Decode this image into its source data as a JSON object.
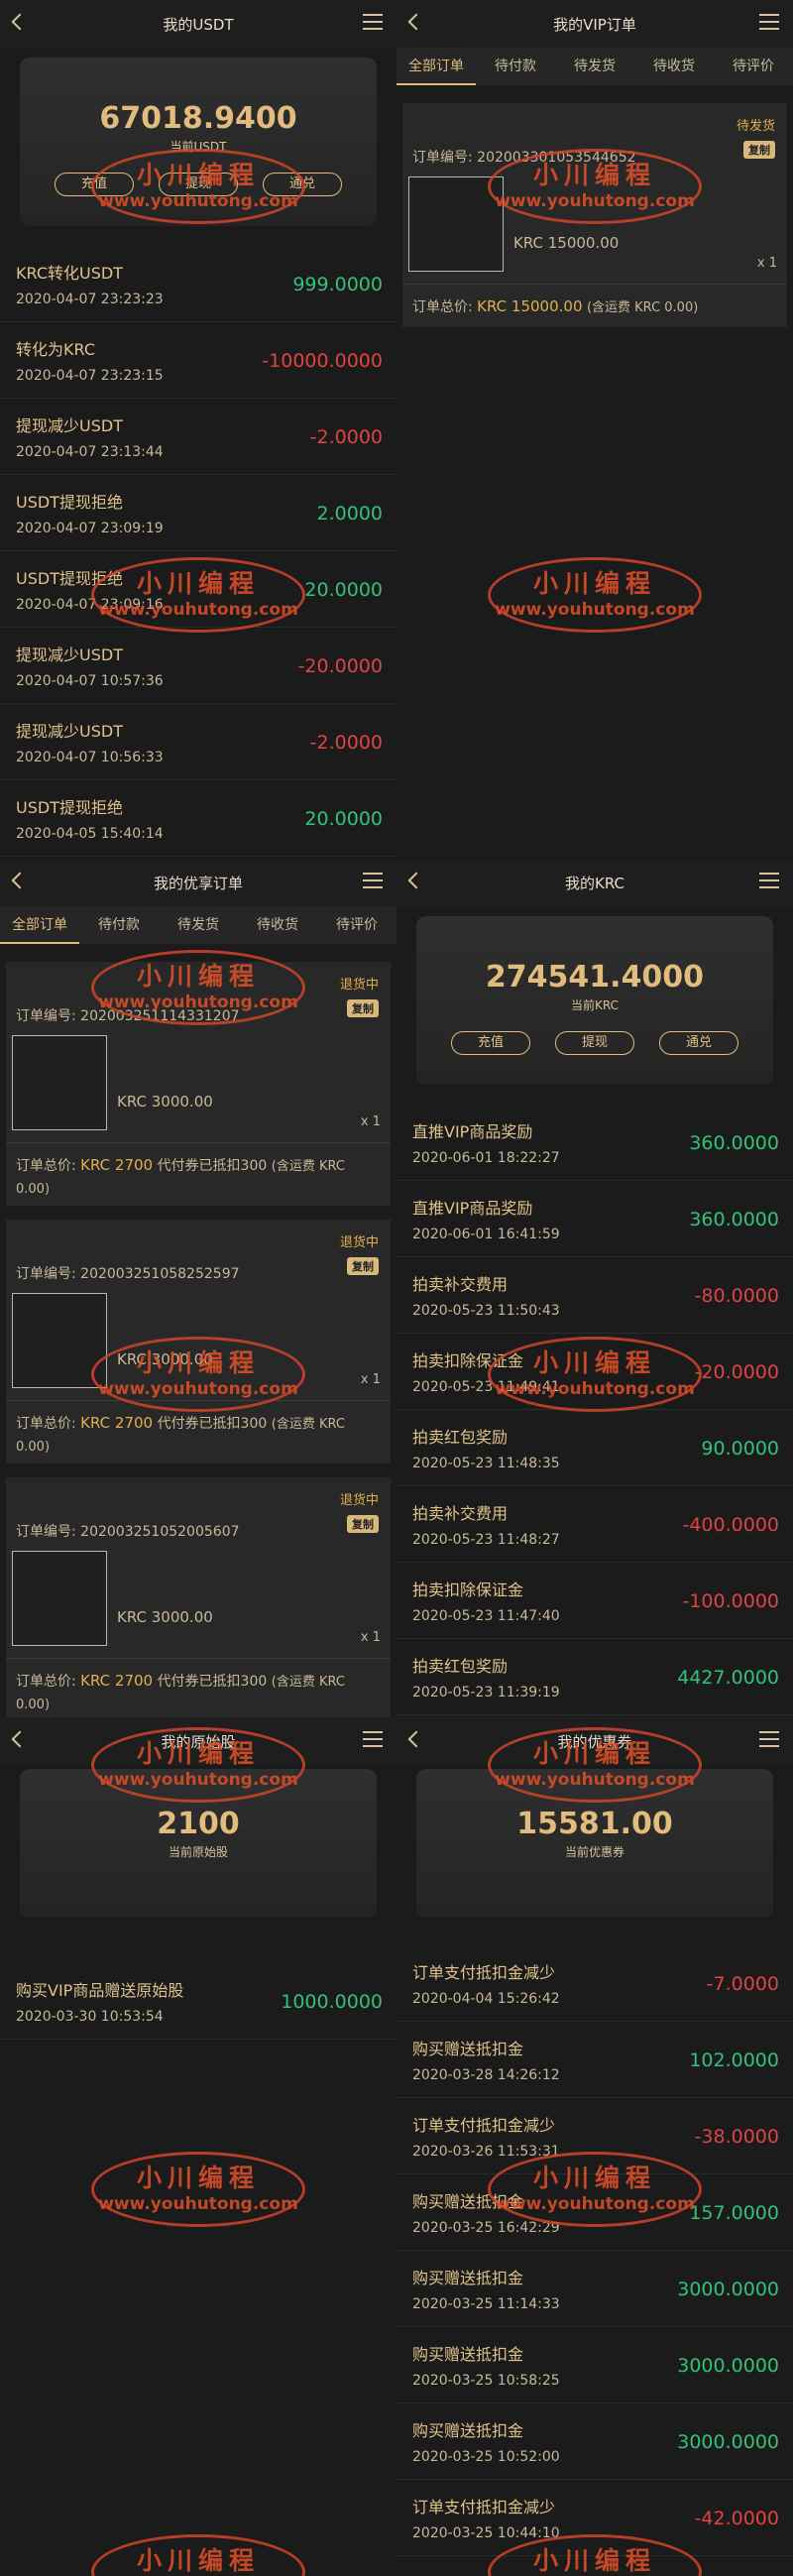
{
  "usdt": {
    "title": "我的USDT",
    "balance": "67018.9400",
    "balance_label": "当前USDT",
    "buttons": [
      "充值",
      "提现",
      "通兑"
    ],
    "records": [
      {
        "name": "KRC转化USDT",
        "time": "2020-04-07 23:23:23",
        "amount": "999.0000",
        "sign": "pos"
      },
      {
        "name": "转化为KRC",
        "time": "2020-04-07 23:23:15",
        "amount": "-10000.0000",
        "sign": "neg"
      },
      {
        "name": "提现减少USDT",
        "time": "2020-04-07 23:13:44",
        "amount": "-2.0000",
        "sign": "neg"
      },
      {
        "name": "USDT提现拒绝",
        "time": "2020-04-07 23:09:19",
        "amount": "2.0000",
        "sign": "pos"
      },
      {
        "name": "USDT提现拒绝",
        "time": "2020-04-07 23:09:16",
        "amount": "20.0000",
        "sign": "pos"
      },
      {
        "name": "提现减少USDT",
        "time": "2020-04-07 10:57:36",
        "amount": "-20.0000",
        "sign": "neg"
      },
      {
        "name": "提现减少USDT",
        "time": "2020-04-07 10:56:33",
        "amount": "-2.0000",
        "sign": "neg"
      },
      {
        "name": "USDT提现拒绝",
        "time": "2020-04-05 15:40:14",
        "amount": "20.0000",
        "sign": "pos"
      }
    ]
  },
  "vip": {
    "title": "我的VIP订单",
    "tabs": [
      "全部订单",
      "待付款",
      "待发货",
      "待收货",
      "待评价"
    ],
    "order": {
      "status": "待发货",
      "copy": "复制",
      "label": "订单编号:",
      "number": "202003301053544652",
      "price": "KRC 15000.00",
      "qty": "x 1",
      "total_label": "订单总价:",
      "total": "KRC 15000.00",
      "note": "(含运费 KRC 0.00)"
    }
  },
  "youxiang": {
    "title": "我的优享订单",
    "tabs": [
      "全部订单",
      "待付款",
      "待发货",
      "待收货",
      "待评价"
    ],
    "orders": [
      {
        "status": "退货中",
        "copy": "复制",
        "label": "订单编号:",
        "number": "202003251114331207",
        "price": "KRC 3000.00",
        "qty": "x 1",
        "total_label": "订单总价:",
        "total": "KRC 2700",
        "deduct": "代付券已抵扣300",
        "note": "(含运费 KRC 0.00)"
      },
      {
        "status": "退货中",
        "copy": "复制",
        "label": "订单编号:",
        "number": "202003251058252597",
        "price": "KRC 3000.00",
        "qty": "x 1",
        "total_label": "订单总价:",
        "total": "KRC 2700",
        "deduct": "代付券已抵扣300",
        "note": "(含运费 KRC 0.00)"
      },
      {
        "status": "退货中",
        "copy": "复制",
        "label": "订单编号:",
        "number": "202003251052005607",
        "price": "KRC 3000.00",
        "qty": "x 1",
        "total_label": "订单总价:",
        "total": "KRC 2700",
        "deduct": "代付券已抵扣300",
        "note": "(含运费 KRC 0.00)"
      }
    ]
  },
  "krc": {
    "title": "我的KRC",
    "balance": "274541.4000",
    "balance_label": "当前KRC",
    "buttons": [
      "充值",
      "提现",
      "通兑"
    ],
    "records": [
      {
        "name": "直推VIP商品奖励",
        "time": "2020-06-01 18:22:27",
        "amount": "360.0000",
        "sign": "pos"
      },
      {
        "name": "直推VIP商品奖励",
        "time": "2020-06-01 16:41:59",
        "amount": "360.0000",
        "sign": "pos"
      },
      {
        "name": "拍卖补交费用",
        "time": "2020-05-23 11:50:43",
        "amount": "-80.0000",
        "sign": "neg"
      },
      {
        "name": "拍卖扣除保证金",
        "time": "2020-05-23 11:49:41",
        "amount": "-20.0000",
        "sign": "neg"
      },
      {
        "name": "拍卖红包奖励",
        "time": "2020-05-23 11:48:35",
        "amount": "90.0000",
        "sign": "pos"
      },
      {
        "name": "拍卖补交费用",
        "time": "2020-05-23 11:48:27",
        "amount": "-400.0000",
        "sign": "neg"
      },
      {
        "name": "拍卖扣除保证金",
        "time": "2020-05-23 11:47:40",
        "amount": "-100.0000",
        "sign": "neg"
      },
      {
        "name": "拍卖红包奖励",
        "time": "2020-05-23 11:39:19",
        "amount": "4427.0000",
        "sign": "pos"
      }
    ]
  },
  "yuanshi": {
    "title": "我的原始股",
    "balance": "2100",
    "balance_label": "当前原始股",
    "records": [
      {
        "name": "购买VIP商品赠送原始股",
        "time": "2020-03-30 10:53:54",
        "amount": "1000.0000",
        "sign": "pos"
      }
    ]
  },
  "coupon": {
    "title": "我的优惠券",
    "balance": "15581.00",
    "balance_label": "当前优惠券",
    "records": [
      {
        "name": "订单支付抵扣金减少",
        "time": "2020-04-04 15:26:42",
        "amount": "-7.0000",
        "sign": "neg"
      },
      {
        "name": "购买赠送抵扣金",
        "time": "2020-03-28 14:26:12",
        "amount": "102.0000",
        "sign": "pos"
      },
      {
        "name": "订单支付抵扣金减少",
        "time": "2020-03-26 11:53:31",
        "amount": "-38.0000",
        "sign": "neg"
      },
      {
        "name": "购买赠送抵扣金",
        "time": "2020-03-25 16:42:29",
        "amount": "157.0000",
        "sign": "pos"
      },
      {
        "name": "购买赠送抵扣金",
        "time": "2020-03-25 11:14:33",
        "amount": "3000.0000",
        "sign": "pos"
      },
      {
        "name": "购买赠送抵扣金",
        "time": "2020-03-25 10:58:25",
        "amount": "3000.0000",
        "sign": "pos"
      },
      {
        "name": "购买赠送抵扣金",
        "time": "2020-03-25 10:52:00",
        "amount": "3000.0000",
        "sign": "pos"
      },
      {
        "name": "订单支付抵扣金减少",
        "time": "2020-03-25 10:44:10",
        "amount": "-42.0000",
        "sign": "neg"
      }
    ]
  },
  "watermark": {
    "line1": "小川编程",
    "line2": "www.youhutong.com"
  },
  "colors": {
    "accent": "#e2bc7d",
    "positive": "#31c27c",
    "negative": "#e04343",
    "background": "#1b1b1b"
  }
}
